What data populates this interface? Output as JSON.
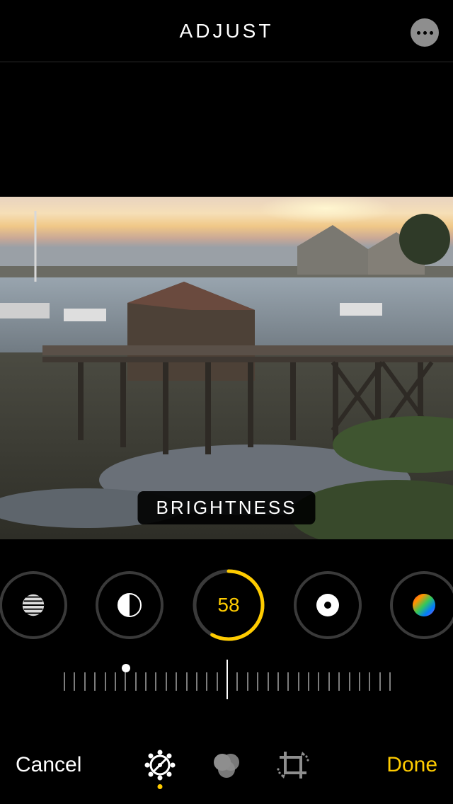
{
  "header": {
    "title": "ADJUST",
    "more_tooltip": "More"
  },
  "parameter": {
    "label": "BRIGHTNESS",
    "value": "58"
  },
  "dials": {
    "exposure": "exposure-icon",
    "contrast": "contrast-icon",
    "brightness_selected": true,
    "black_point": "black-point-icon",
    "saturation": "saturation-icon"
  },
  "bottom": {
    "cancel": "Cancel",
    "done": "Done"
  },
  "modes": {
    "adjust_selected": true
  },
  "colors": {
    "accent": "#ffcc00"
  }
}
